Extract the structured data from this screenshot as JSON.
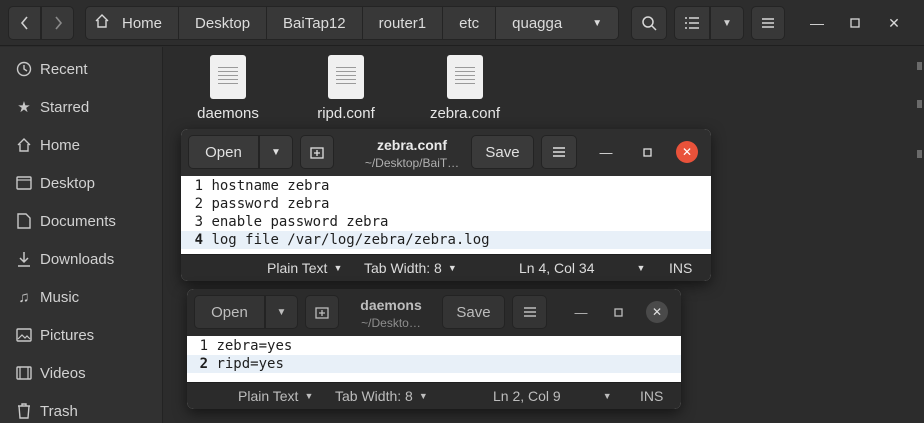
{
  "file_manager": {
    "breadcrumbs": [
      "Home",
      "Desktop",
      "BaiTap12",
      "router1",
      "etc",
      "quagga"
    ],
    "sidebar": [
      {
        "label": "Recent",
        "icon": "clock-icon"
      },
      {
        "label": "Starred",
        "icon": "star-icon"
      },
      {
        "label": "Home",
        "icon": "home-icon"
      },
      {
        "label": "Desktop",
        "icon": "desktop-folder-icon"
      },
      {
        "label": "Documents",
        "icon": "documents-icon"
      },
      {
        "label": "Downloads",
        "icon": "download-icon"
      },
      {
        "label": "Music",
        "icon": "music-icon"
      },
      {
        "label": "Pictures",
        "icon": "pictures-icon"
      },
      {
        "label": "Videos",
        "icon": "videos-icon"
      },
      {
        "label": "Trash",
        "icon": "trash-icon"
      }
    ],
    "files": [
      "daemons",
      "ripd.conf",
      "zebra.conf"
    ]
  },
  "editor_zebra": {
    "open_label": "Open",
    "save_label": "Save",
    "title": "zebra.conf",
    "subtitle": "~/Desktop/BaiT…",
    "lines": [
      {
        "num": "1",
        "text": "hostname zebra"
      },
      {
        "num": "2",
        "text": "password zebra"
      },
      {
        "num": "3",
        "text": "enable password zebra"
      },
      {
        "num": "4",
        "text": "log file /var/log/zebra/zebra.log"
      }
    ],
    "status": {
      "language": "Plain Text",
      "tab_width": "Tab Width: 8",
      "position": "Ln 4, Col 34",
      "mode": "INS"
    }
  },
  "editor_daemons": {
    "open_label": "Open",
    "save_label": "Save",
    "title": "daemons",
    "subtitle": "~/Deskto…",
    "lines": [
      {
        "num": "1",
        "text": "zebra=yes"
      },
      {
        "num": "2",
        "text": "ripd=yes"
      }
    ],
    "status": {
      "language": "Plain Text",
      "tab_width": "Tab Width: 8",
      "position": "Ln 2, Col 9",
      "mode": "INS"
    }
  },
  "colors": {
    "close_active": "#e9523a",
    "chrome_dark": "#2d2d2d",
    "active_line": "#e8f0f8"
  }
}
